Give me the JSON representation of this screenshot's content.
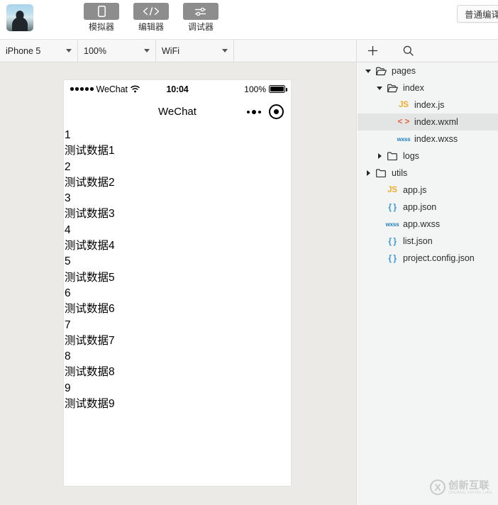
{
  "toolbar": {
    "avatar_alt": "user-avatar",
    "buttons": [
      {
        "label": "模拟器",
        "icon": "phone-icon"
      },
      {
        "label": "编辑器",
        "icon": "code-icon"
      },
      {
        "label": "调试器",
        "icon": "sliders-icon"
      }
    ],
    "compile_label": "普通编译"
  },
  "subbar": {
    "device": "iPhone 5",
    "zoom": "100%",
    "network": "WiFi",
    "add_icon": "plus-icon",
    "search_icon": "search-icon"
  },
  "simulator": {
    "statusbar": {
      "carrier": "WeChat",
      "time": "10:04",
      "battery_percent": "100%"
    },
    "navbar": {
      "title": "WeChat",
      "menu_icon": "more-dots-icon",
      "target_icon": "target-icon"
    },
    "list": [
      "1",
      "测试数据1",
      "2",
      "测试数据2",
      "3",
      "测试数据3",
      "4",
      "测试数据4",
      "5",
      "测试数据5",
      "6",
      "测试数据6",
      "7",
      "测试数据7",
      "8",
      "测试数据8",
      "9",
      "测试数据9"
    ]
  },
  "filetree": [
    {
      "name": "pages",
      "type": "folder",
      "state": "expanded",
      "depth": 0,
      "selected": false
    },
    {
      "name": "index",
      "type": "folder",
      "state": "expanded",
      "depth": 1,
      "selected": false
    },
    {
      "name": "index.js",
      "type": "js",
      "state": "file",
      "depth": 2,
      "selected": false
    },
    {
      "name": "index.wxml",
      "type": "wxml",
      "state": "file",
      "depth": 2,
      "selected": true
    },
    {
      "name": "index.wxss",
      "type": "wxss",
      "state": "file",
      "depth": 2,
      "selected": false
    },
    {
      "name": "logs",
      "type": "folder",
      "state": "collapsed",
      "depth": 1,
      "selected": false
    },
    {
      "name": "utils",
      "type": "folder",
      "state": "collapsed",
      "depth": 0,
      "selected": false
    },
    {
      "name": "app.js",
      "type": "js",
      "state": "file",
      "depth": 1,
      "selected": false
    },
    {
      "name": "app.json",
      "type": "json",
      "state": "file",
      "depth": 1,
      "selected": false
    },
    {
      "name": "app.wxss",
      "type": "wxss",
      "state": "file",
      "depth": 1,
      "selected": false
    },
    {
      "name": "list.json",
      "type": "json",
      "state": "file",
      "depth": 1,
      "selected": false
    },
    {
      "name": "project.config.json",
      "type": "json",
      "state": "file",
      "depth": 1,
      "selected": false
    }
  ],
  "watermark": {
    "cn": "创新互联",
    "en": "CHUANG XIN HU LIAN"
  },
  "colors": {
    "js": "#f0ad2e",
    "wxml": "#e8643c",
    "wxss": "#1d7fc4",
    "json": "#3a9ad9",
    "selection": "#e3e4e4",
    "sim_bg": "#eceae6",
    "panel_bg": "#f3f4f4"
  }
}
